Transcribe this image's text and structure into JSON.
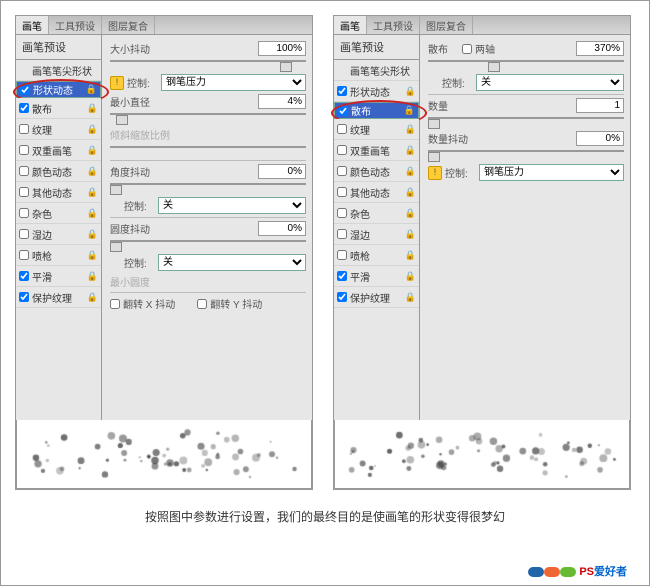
{
  "tabs": {
    "brush": "画笔",
    "tool": "工具预设",
    "layer": "图层复合"
  },
  "sidebar": {
    "head": "画笔预设",
    "items": [
      {
        "label": "画笔笔尖形状",
        "cb": null,
        "lock": false
      },
      {
        "label": "形状动态",
        "cb": true,
        "lock": true
      },
      {
        "label": "散布",
        "cb": true,
        "lock": true
      },
      {
        "label": "纹理",
        "cb": false,
        "lock": true
      },
      {
        "label": "双重画笔",
        "cb": false,
        "lock": true
      },
      {
        "label": "颜色动态",
        "cb": false,
        "lock": true
      },
      {
        "label": "其他动态",
        "cb": false,
        "lock": true
      },
      {
        "label": "杂色",
        "cb": false,
        "lock": true
      },
      {
        "label": "湿边",
        "cb": false,
        "lock": true
      },
      {
        "label": "喷枪",
        "cb": false,
        "lock": true
      },
      {
        "label": "平滑",
        "cb": true,
        "lock": true
      },
      {
        "label": "保护纹理",
        "cb": true,
        "lock": true
      }
    ]
  },
  "left": {
    "size_jitter_lbl": "大小抖动",
    "size_jitter": "100%",
    "ctrl": "控制:",
    "pen": "钢笔压力",
    "min_dia_lbl": "最小直径",
    "min_dia": "4%",
    "tilt": "倾斜缩放比例",
    "angle_lbl": "角度抖动",
    "angle": "0%",
    "off": "关",
    "round_lbl": "圆度抖动",
    "round": "0%",
    "min_round": "最小圆度",
    "flipx": "翻转 X 抖动",
    "flipy": "翻转 Y 抖动"
  },
  "right": {
    "scatter_lbl": "散布",
    "both": "两轴",
    "scatter": "370%",
    "ctrl": "控制:",
    "off": "关",
    "count_lbl": "数量",
    "count": "1",
    "count_jit_lbl": "数量抖动",
    "count_jit": "0%",
    "pen": "钢笔压力"
  },
  "caption": "按照图中参数进行设置，我们的最终目的是使画笔的形状变得很梦幻",
  "logo": {
    "a": "PS",
    "b": "爱好者"
  }
}
